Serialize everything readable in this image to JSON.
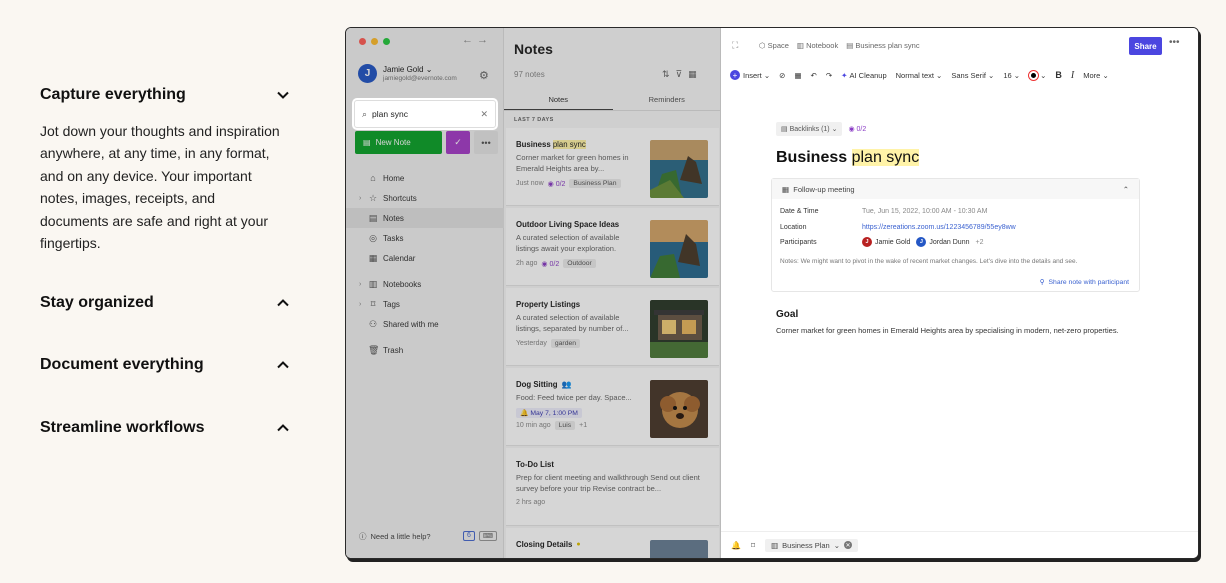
{
  "accordion": {
    "items": [
      {
        "title": "Capture everything",
        "body": "Jot down your thoughts and inspiration anywhere, at any time, in any format, and on any device. Your important notes, images, receipts, and documents are safe and right at your fingertips."
      },
      {
        "title": "Stay organized"
      },
      {
        "title": "Document everything"
      },
      {
        "title": "Streamline workflows"
      }
    ]
  },
  "app": {
    "account": {
      "initial": "J",
      "name": "Jamie Gold",
      "email": "jamiegold@evernote.com"
    },
    "search": {
      "value": "plan sync"
    },
    "new_note_label": "New Note",
    "nav": [
      "Home",
      "Shortcuts",
      "Notes",
      "Tasks",
      "Calendar",
      "Notebooks",
      "Tags",
      "Shared with me",
      "Trash"
    ],
    "help_label": "Need a little help?",
    "help_badge": "6",
    "notes_title": "Notes",
    "notes_count": "97 notes",
    "tabs": [
      "Notes",
      "Reminders"
    ],
    "section_label": "LAST 7 DAYS",
    "notes": [
      {
        "title_pre": "Business ",
        "title_hl": "plan sync",
        "snippet": "Corner market for green homes in Emerald Heights area by...",
        "time": "Just now",
        "tasks": "0/2",
        "tag": "Business Plan"
      },
      {
        "title": "Outdoor Living Space Ideas",
        "snippet": "A curated selection of available listings await your exploration.",
        "time": "2h ago",
        "tasks": "0/2",
        "tag": "Outdoor"
      },
      {
        "title": "Property Listings",
        "snippet": "A curated selection of available listings, separated by number of...",
        "time": "Yesterday",
        "tag": "garden"
      },
      {
        "title": "Dog Sitting",
        "snippet": "Food: Feed twice per day. Space...",
        "reminder": "May 7, 1:00 PM",
        "time": "10 min ago",
        "tag": "Luis",
        "extra": "+1"
      },
      {
        "title": "To-Do List",
        "snippet": "Prep for client meeting and walkthrough Send out client survey before your trip Revise contract be...",
        "time": "2 hrs ago"
      },
      {
        "title": "Closing Details"
      }
    ],
    "editor": {
      "breadcrumbs": [
        "Space",
        "Notebook",
        "Business plan sync"
      ],
      "share_label": "Share",
      "toolbar": {
        "insert": "Insert",
        "ai": "AI Cleanup",
        "style": "Normal text",
        "font": "Sans Serif",
        "size": "16",
        "more": "More"
      },
      "backlinks": "Backlinks (1)",
      "tasks": "0/2",
      "title_pre": "Business ",
      "title_hl": "plan sync",
      "meeting": {
        "title": "Follow-up meeting",
        "date_label": "Date & Time",
        "date_value": "Tue, Jun 15, 2022, 10:00 AM - 10:30 AM",
        "location_label": "Location",
        "location_value": "https://zereations.zoom.us/1223456789/55ey8ww",
        "participants_label": "Participants",
        "participants": [
          {
            "initial": "J",
            "name": "Jamie Gold",
            "color": "#b82121"
          },
          {
            "initial": "J",
            "name": "Jordan Dunn",
            "color": "#2457c5"
          }
        ],
        "more_participants": "+2",
        "notes": "Notes: We might want to pivot in the wake of recent market changes. Let's dive into the details and see.",
        "share_link": "Share note with participant"
      },
      "goal_heading": "Goal",
      "goal_text": "Corner market for green homes in Emerald Heights area by specialising in modern, net-zero properties.",
      "notebook_chip": "Business Plan"
    }
  }
}
